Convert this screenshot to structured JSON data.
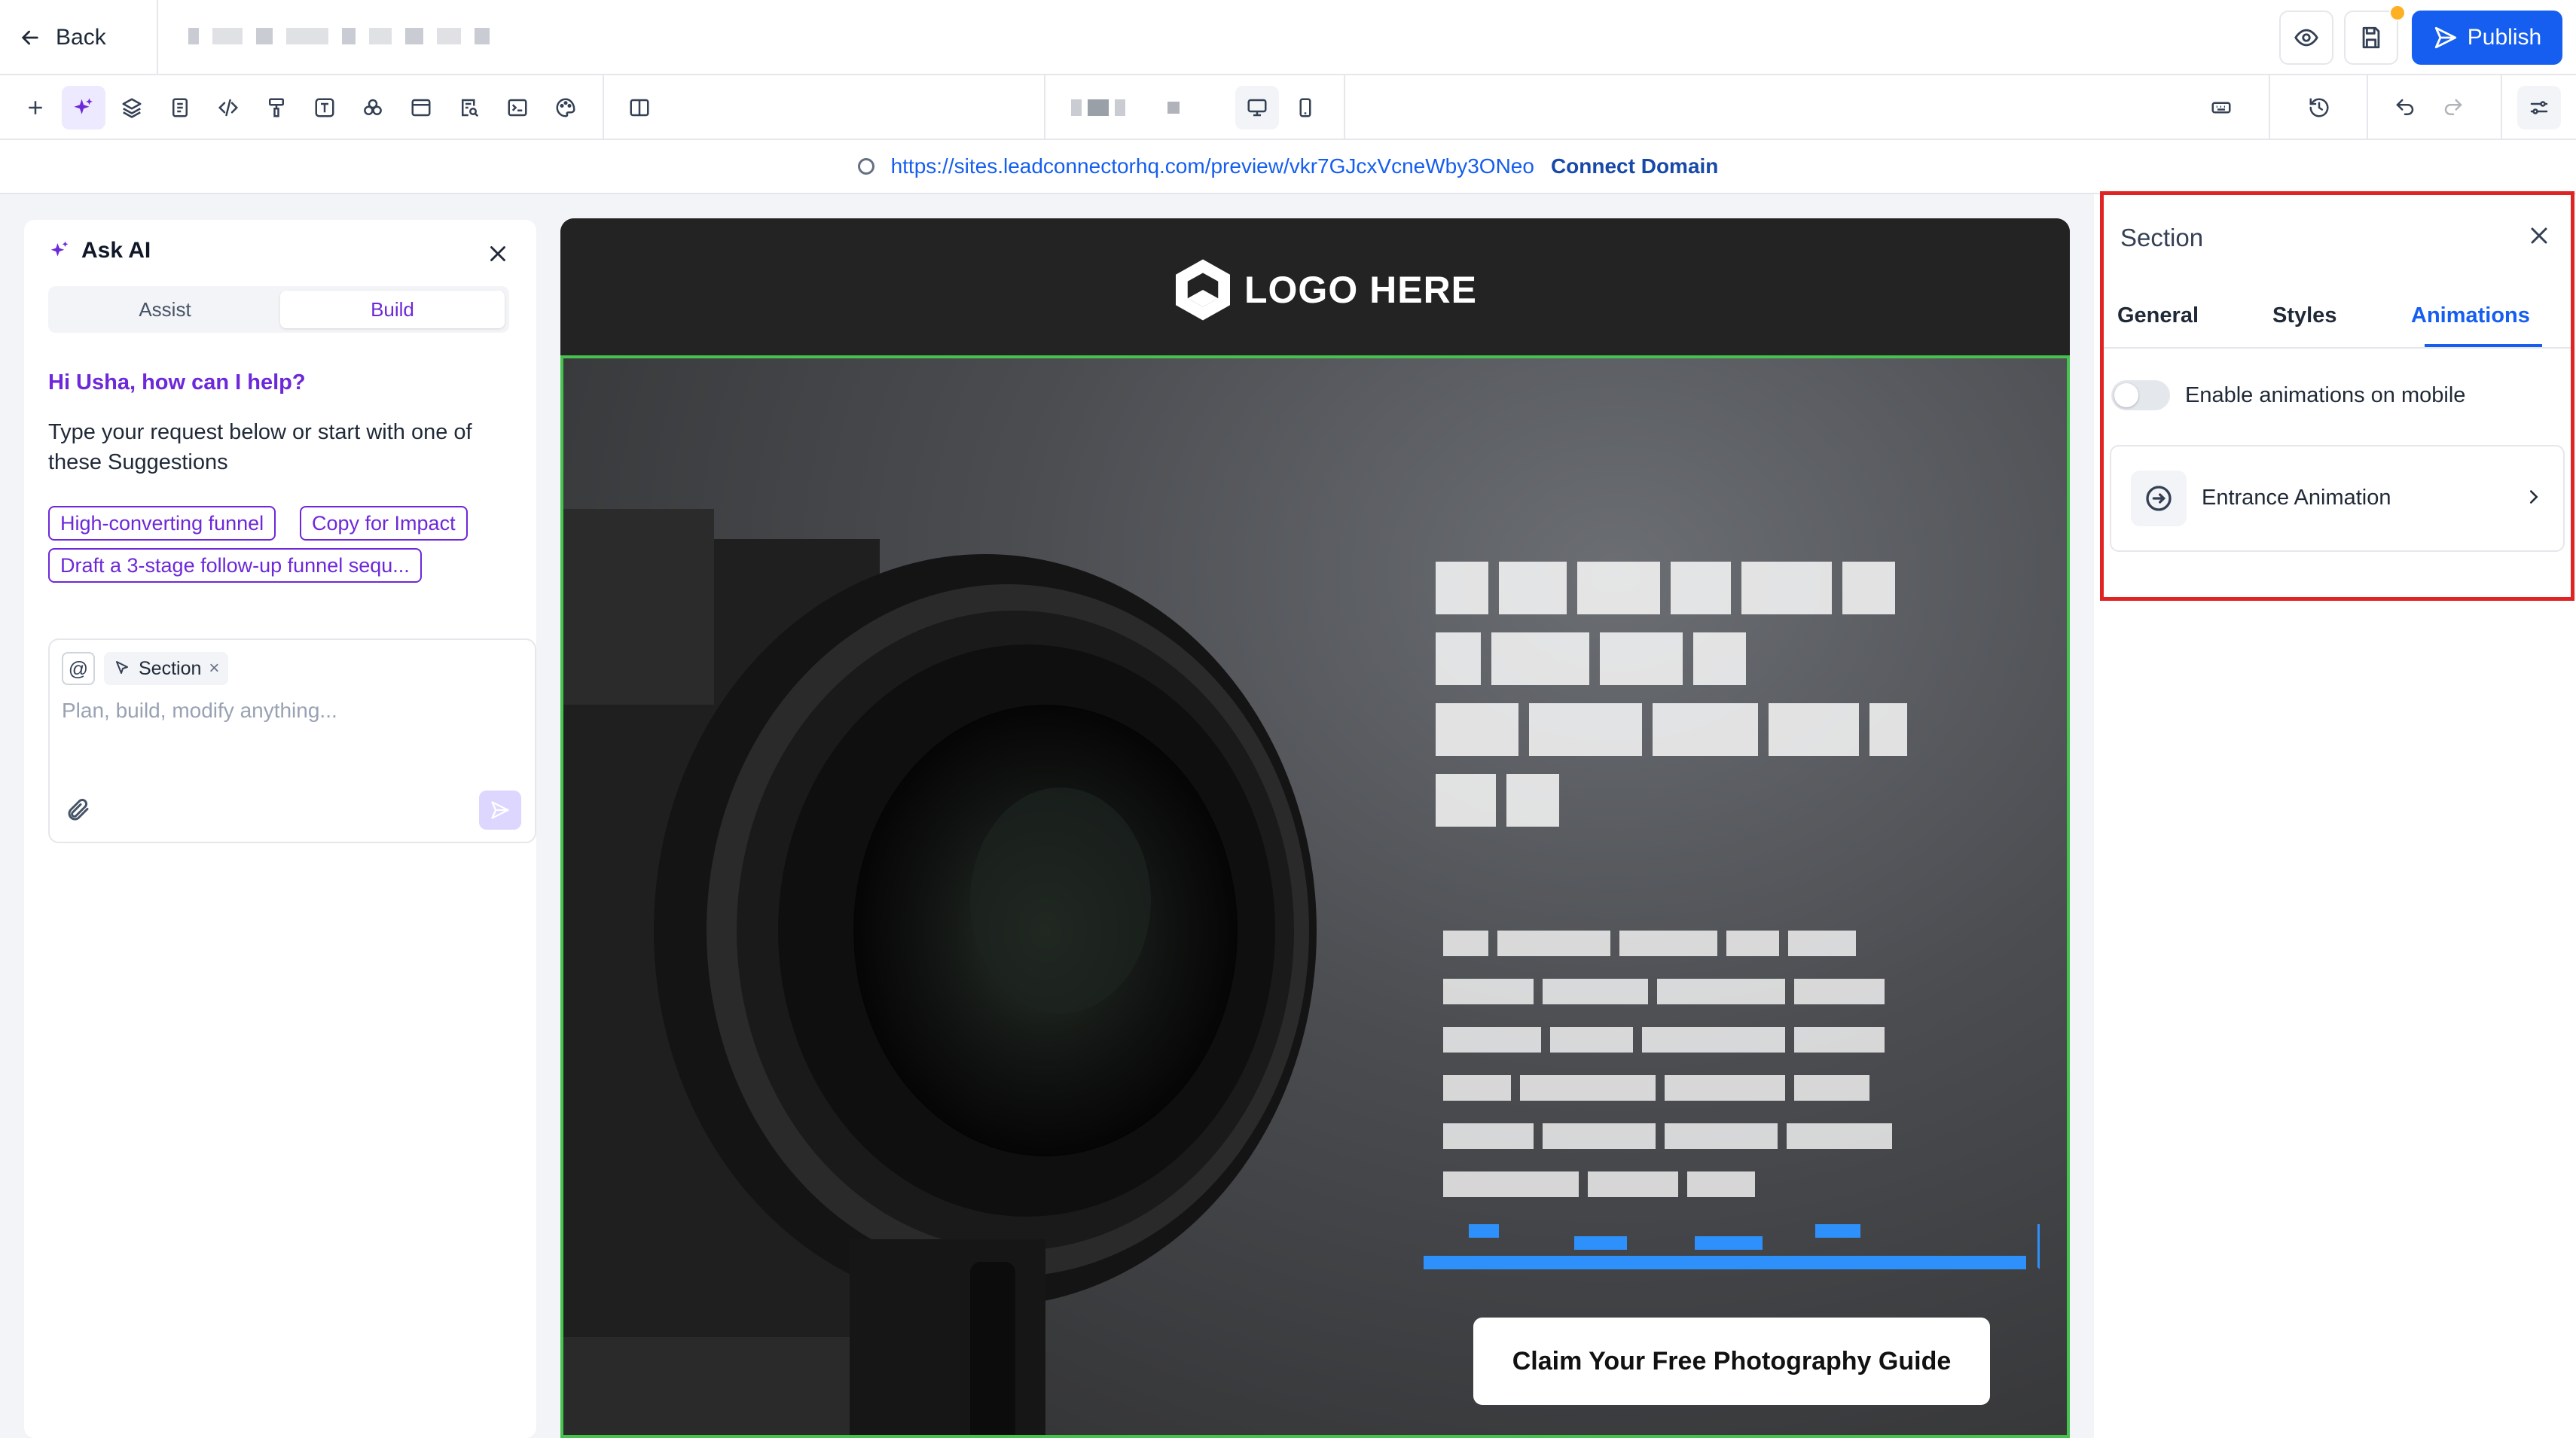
{
  "topbar": {
    "back_label": "Back",
    "publish_label": "Publish"
  },
  "url": {
    "link": "https://sites.leadconnectorhq.com/preview/vkr7GJcxVcneWby3ONeo",
    "connect_label": "Connect Domain"
  },
  "ask_ai": {
    "title": "Ask AI",
    "tabs": [
      "Assist",
      "Build"
    ],
    "active_tab": "Build",
    "greeting": "Hi Usha, how can I help?",
    "description": "Type your request below or start with one of these Suggestions",
    "suggestions": [
      "High-converting funnel",
      "Copy for Impact",
      "Draft a 3-stage follow-up funnel sequ..."
    ],
    "context_tag": "Section",
    "placeholder": "Plan, build, modify anything..."
  },
  "preview": {
    "logo_text": "LOGO HERE",
    "cta_label": "Claim Your Free Photography Guide"
  },
  "settings": {
    "title": "Section",
    "tabs": [
      "General",
      "Styles",
      "Animations"
    ],
    "active_tab": "Animations",
    "toggle_label": "Enable animations on mobile",
    "toggle_on": false,
    "entrance_label": "Entrance Animation"
  },
  "colors": {
    "primary": "#155eef",
    "ai_accent": "#6d28d9",
    "selection_outline": "#47c24f",
    "highlight_box": "#e02424"
  }
}
